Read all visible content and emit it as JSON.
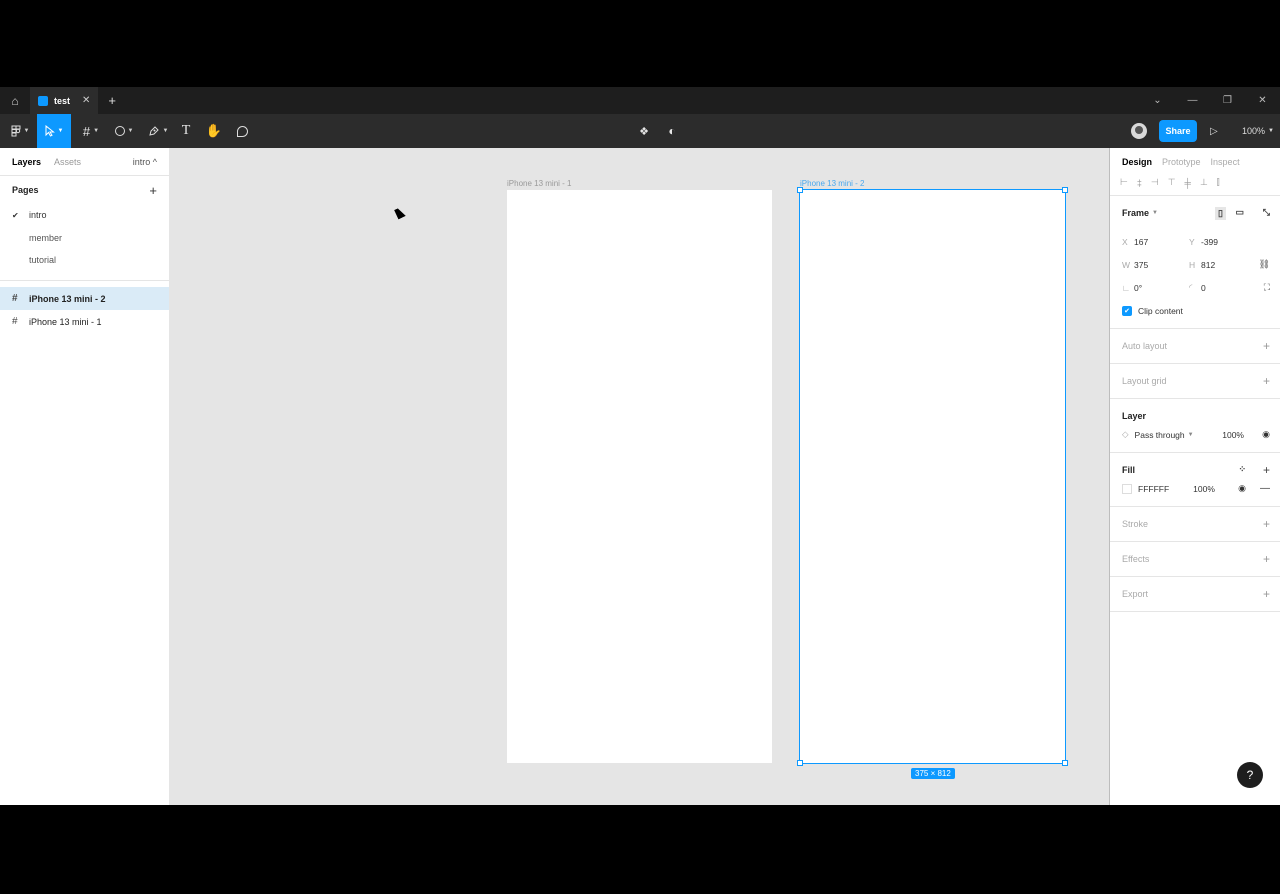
{
  "tabbar": {
    "file_tab": "test",
    "close": "✕",
    "add": "+",
    "window": {
      "dropdown": "⌄",
      "minimize": "—",
      "restore": "❐",
      "close": "✕"
    }
  },
  "toolbar": {
    "share_label": "Share",
    "zoom": "100%"
  },
  "left_panel": {
    "tabs": {
      "layers": "Layers",
      "assets": "Assets",
      "current_page": "intro ^"
    },
    "pages_title": "Pages",
    "pages": [
      {
        "label": "intro",
        "checked": true
      },
      {
        "label": "member",
        "checked": false
      },
      {
        "label": "tutorial",
        "checked": false
      }
    ],
    "layers": [
      {
        "label": "iPhone 13 mini - 2",
        "selected": true
      },
      {
        "label": "iPhone 13 mini - 1",
        "selected": false
      }
    ]
  },
  "canvas": {
    "frame1_label": "iPhone 13 mini - 1",
    "frame2_label": "iPhone 13 mini - 2",
    "size_badge": "375 × 812"
  },
  "right_panel": {
    "tabs": {
      "design": "Design",
      "prototype": "Prototype",
      "inspect": "Inspect"
    },
    "frame": {
      "title": "Frame",
      "x_label": "X",
      "x": "167",
      "y_label": "Y",
      "y": "-399",
      "w_label": "W",
      "w": "375",
      "h_label": "H",
      "h": "812",
      "rotation": "0°",
      "radius": "0",
      "clip_content": "Clip content"
    },
    "auto_layout": "Auto layout",
    "layout_grid": "Layout grid",
    "layer": {
      "title": "Layer",
      "blend": "Pass through",
      "opacity": "100%"
    },
    "fill": {
      "title": "Fill",
      "hex": "FFFFFF",
      "opacity": "100%"
    },
    "stroke": "Stroke",
    "effects": "Effects",
    "export": "Export"
  },
  "help": "?",
  "colors": {
    "accent": "#0d99ff",
    "toolbar": "#2c2c2c",
    "canvas": "#e5e5e5"
  }
}
